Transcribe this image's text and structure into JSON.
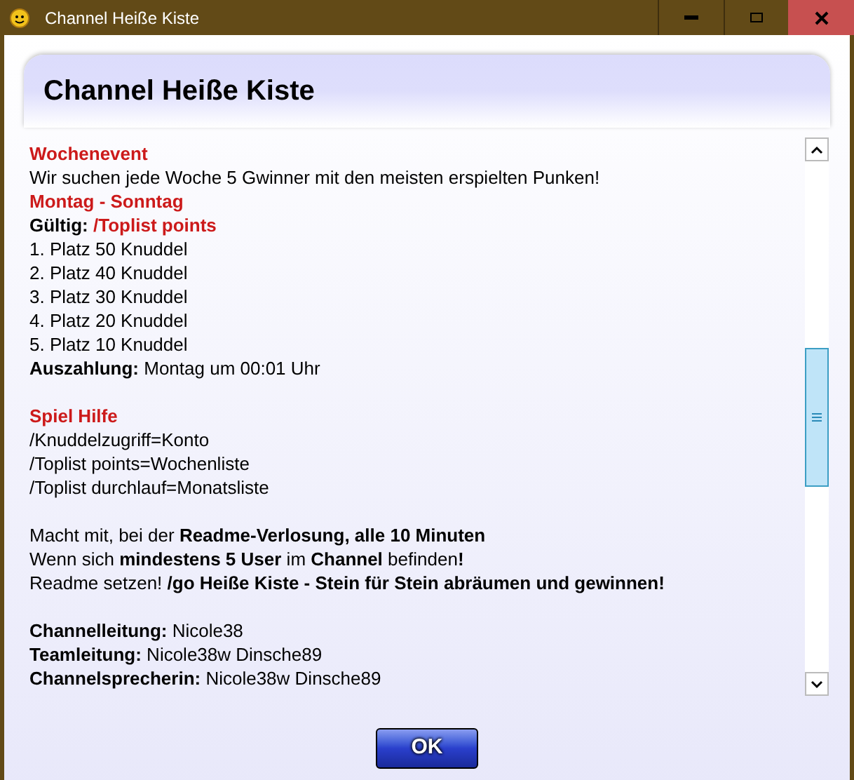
{
  "window": {
    "title": "Channel Heiße Kiste"
  },
  "header": {
    "title": "Channel Heiße Kiste"
  },
  "paragraphs": [
    [
      {
        "kind": "heading",
        "text": "Wochenevent"
      },
      {
        "kind": "text",
        "text": "Wir suchen jede Woche 5 Gwinner mit den meisten erspielten Punken!"
      },
      {
        "kind": "heading",
        "text": "Montag - Sonntag"
      },
      {
        "kind": "field_red",
        "label": "Gültig:",
        "value": "/Toplist points"
      },
      {
        "kind": "text",
        "text": "1. Platz 50 Knuddel"
      },
      {
        "kind": "text",
        "text": "2. Platz 40 Knuddel"
      },
      {
        "kind": "text",
        "text": "3. Platz 30 Knuddel"
      },
      {
        "kind": "text",
        "text": "4. Platz 20 Knuddel"
      },
      {
        "kind": "text",
        "text": "5. Platz 10 Knuddel"
      },
      {
        "kind": "text",
        "text": "**Auszahlung:** Montag um 00:01 Uhr"
      }
    ],
    [
      {
        "kind": "heading",
        "text": "Spiel Hilfe"
      },
      {
        "kind": "text",
        "text": "/Knuddelzugriff=Konto"
      },
      {
        "kind": "text",
        "text": "/Toplist points=Wochenliste"
      },
      {
        "kind": "text",
        "text": "/Toplist durchlauf=Monatsliste"
      }
    ],
    [
      {
        "kind": "text",
        "text": "Macht mit, bei der **Readme-Verlosung, alle 10 Minuten**"
      },
      {
        "kind": "text",
        "text": "Wenn sich **mindestens 5 User** im **Channel** befinden**!**"
      },
      {
        "kind": "text",
        "text": "Readme setzen! **/go Heiße Kiste - Stein für Stein abräumen und gewinnen!**"
      }
    ],
    [
      {
        "kind": "text",
        "text": "**Channelleitung:** Nicole38"
      },
      {
        "kind": "text",
        "text": "**Teamleitung:** Nicole38w Dinsche89"
      },
      {
        "kind": "text",
        "text": "**Channelsprecherin:** Nicole38w Dinsche89"
      }
    ]
  ],
  "ok_button": {
    "label": "OK"
  }
}
